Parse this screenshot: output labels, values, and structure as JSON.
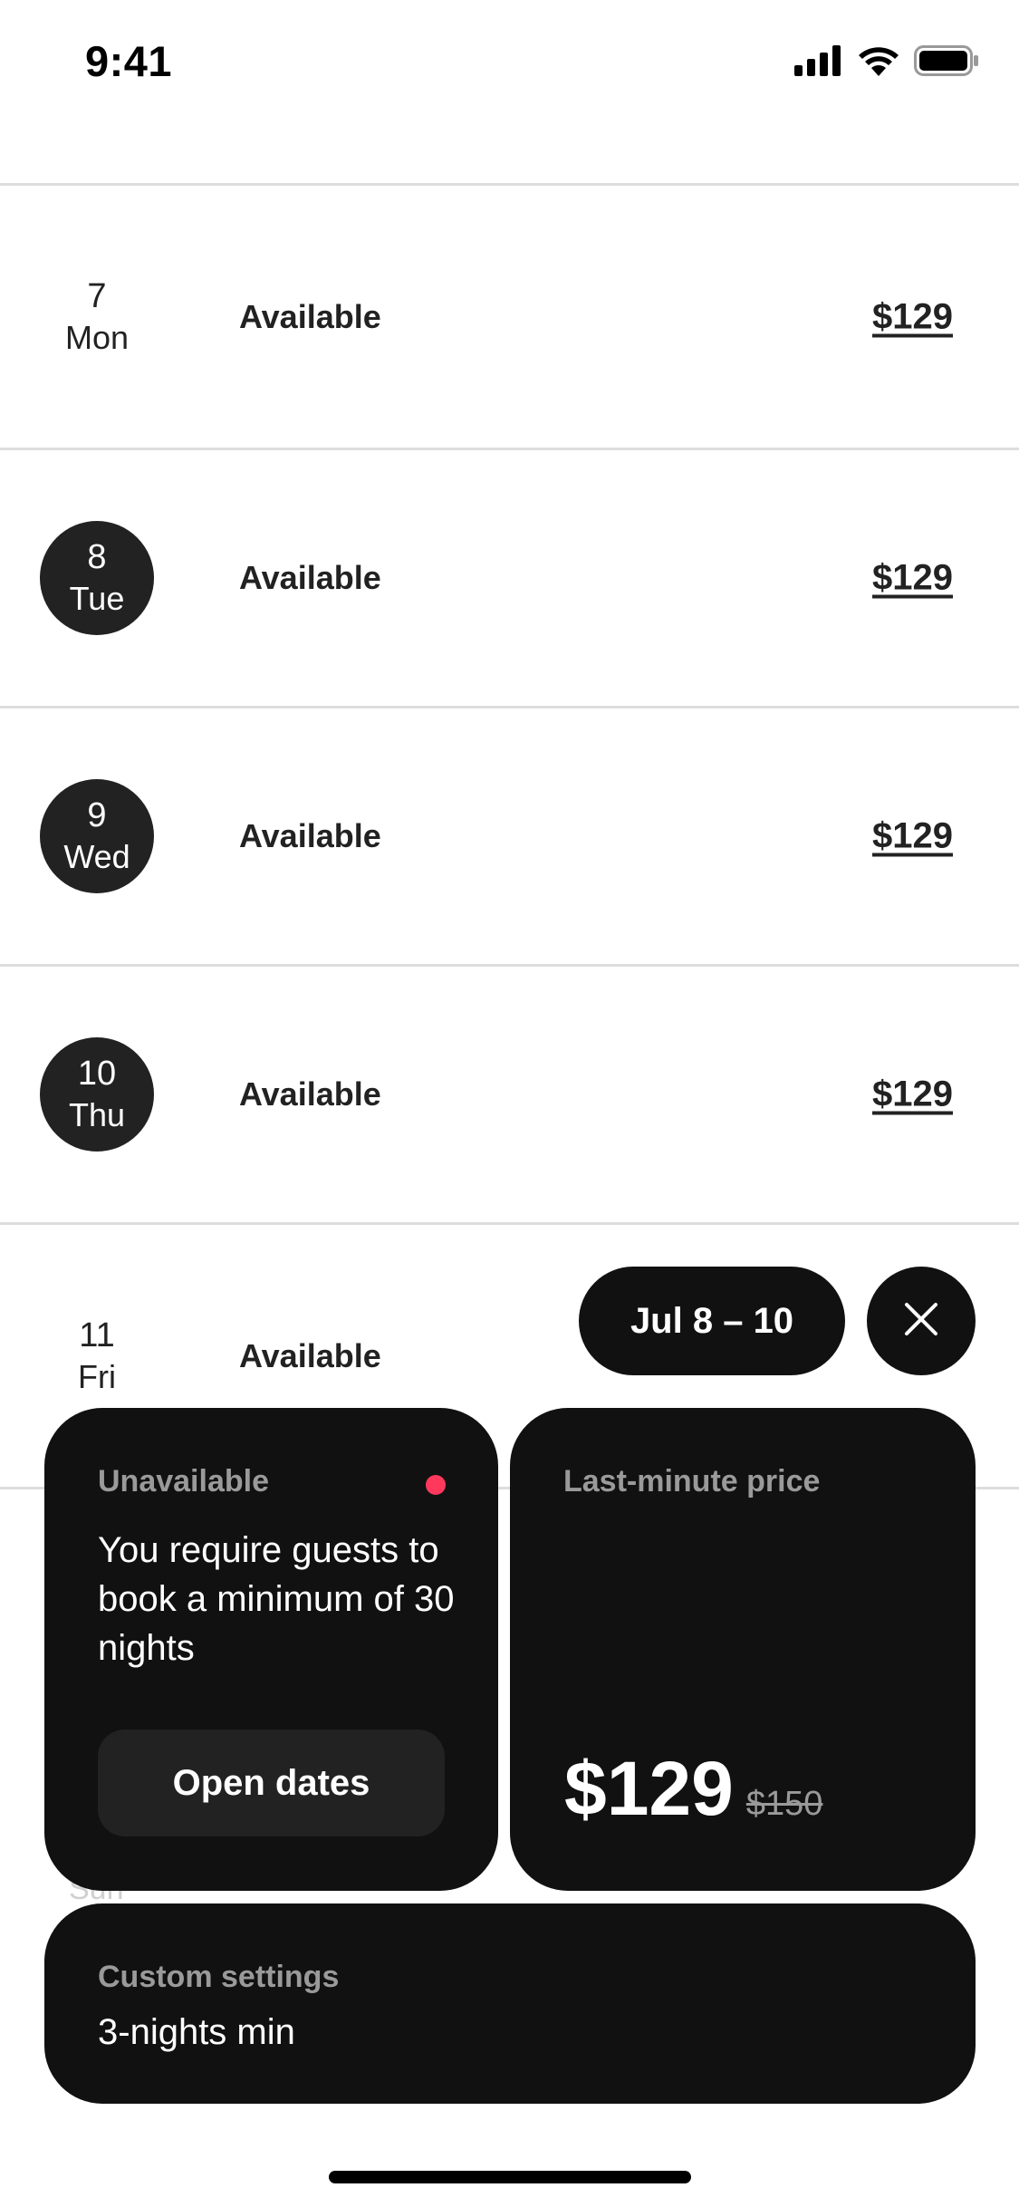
{
  "status_bar": {
    "time": "9:41"
  },
  "calendar": {
    "rows": [
      {
        "day_num": "7",
        "day_name": "Mon",
        "status": "Available",
        "price": "$129",
        "selected": false
      },
      {
        "day_num": "8",
        "day_name": "Tue",
        "status": "Available",
        "price": "$129",
        "selected": true
      },
      {
        "day_num": "9",
        "day_name": "Wed",
        "status": "Available",
        "price": "$129",
        "selected": true
      },
      {
        "day_num": "10",
        "day_name": "Thu",
        "status": "Available",
        "price": "$129",
        "selected": true
      },
      {
        "day_num": "11",
        "day_name": "Fri",
        "status": "Available",
        "price": "",
        "selected": false
      }
    ],
    "peek_day": "Sun"
  },
  "selection_pill": {
    "label": "Jul 8 – 10"
  },
  "icons": {
    "close": "close-icon",
    "signal": "signal-icon",
    "wifi": "wifi-icon",
    "battery": "battery-icon"
  },
  "card_unavailable": {
    "label": "Unavailable",
    "message": "You require guests to book a minimum of 30 nights",
    "button_label": "Open dates",
    "indicator_color": "#ff385c"
  },
  "card_price": {
    "label": "Last-minute price",
    "current_price": "$129",
    "original_price": "$150"
  },
  "card_custom": {
    "label": "Custom settings",
    "value": "3-nights min"
  },
  "colors": {
    "card_background": "#111111",
    "selected_date": "#222222",
    "divider": "#dddddd"
  }
}
